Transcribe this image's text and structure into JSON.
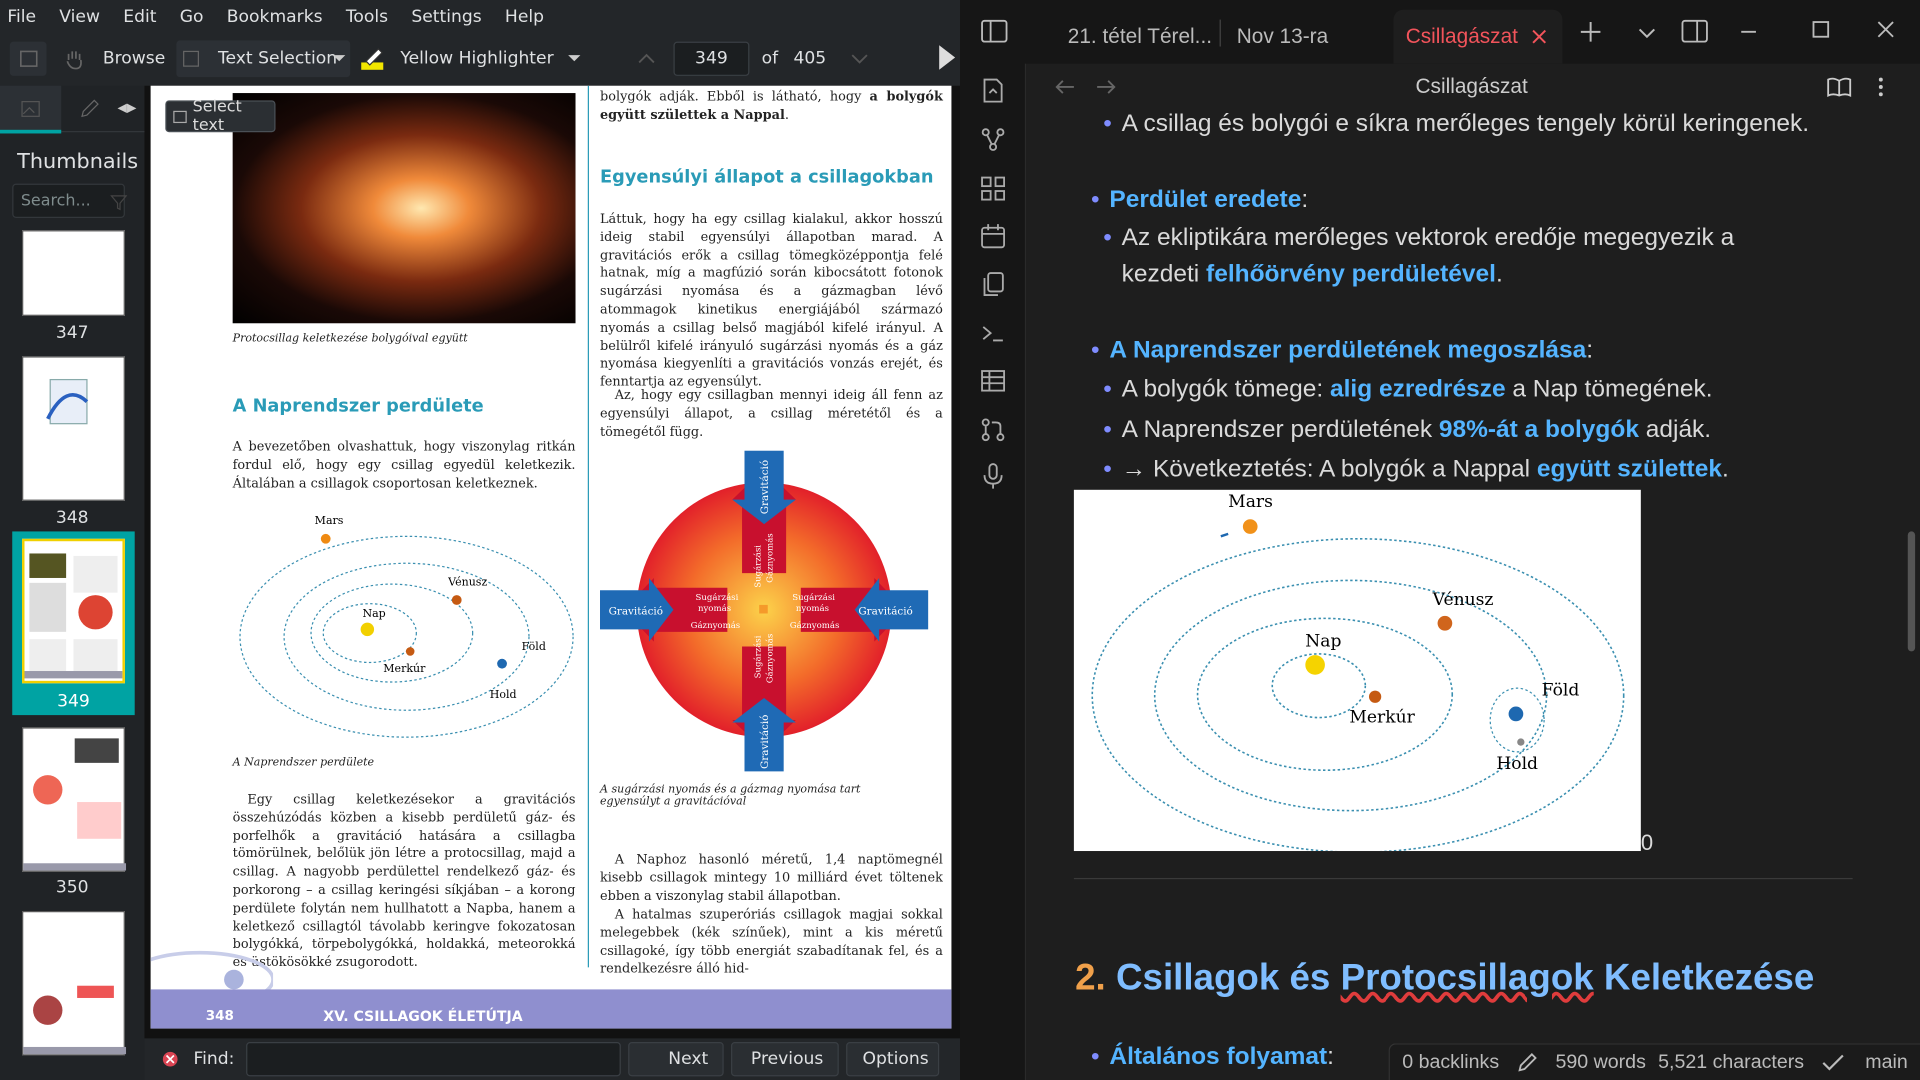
{
  "okular": {
    "menu": [
      "File",
      "View",
      "Edit",
      "Go",
      "Bookmarks",
      "Tools",
      "Settings",
      "Help"
    ],
    "toolbar": {
      "browse": "Browse",
      "text_selection": "Text Selection",
      "highlighter": "Yellow Highlighter",
      "page_current": "349",
      "page_of": "of",
      "page_total": "405"
    },
    "tooltip": "Select text",
    "sidebar": {
      "title": "Thumbnails",
      "search_placeholder": "Search...",
      "pages": [
        "347",
        "348",
        "349",
        "350"
      ]
    },
    "find": {
      "label": "Find:",
      "next": "Next",
      "previous": "Previous",
      "options": "Options"
    },
    "left_page": {
      "caption1": "Protocsillag keletkezése bolygóival együtt",
      "heading": "A Naprendszer perdülete",
      "para1": "A bevezetőben olvashattuk, hogy viszonylag ritkán fordul elő, hogy egy csillag egyedül keletkezik. Általában a csillagok csoportosan keletkeznek.",
      "planets": {
        "mars": "Mars",
        "venus": "Vénusz",
        "sun": "Nap",
        "mercury": "Merkúr",
        "earth": "Föld",
        "moon": "Hold"
      },
      "caption2": "A Naprendszer perdülete",
      "para2": "Egy csillag keletkezésekor a gravitációs összehúzódás közben a kisebb perdületű gáz- és porfelhők a gravitáció hatására a csillagba tömörülnek, belőlük jön létre a protocsillag, majd a csillag. A nagyobb perdülettel rendelkező gáz- és porkorong – a csillag keringési síkjában – a korong perdülete folytán nem hullhatott a Napba, hanem a keletkező csillagtól távolabb keringve fokozatosan bolygókká, törpebolygókká, holdakká, meteorokká és üstökösökké zsugorodott.",
      "footer_num": "348",
      "footer_title": "XV. CSILLAGOK ÉLETÚTJA"
    },
    "right_page": {
      "intro_plain": "bolygók adják. Ebből is látható, hogy ",
      "intro_bold": "a bolygók együtt születtek a Nappal",
      "heading": "Egyensúlyi állapot a csillagokban",
      "para1": "Láttuk, hogy ha egy csillag kialakul, akkor hosszú ideig stabil egyensúlyi állapotban marad. A gravitációs erők a csillag tömegközéppontja felé hatnak, míg a magfúzió során kibocsátott fotonok sugárzási nyomása és a gázmagban lévő atommagok kinetikus energiájából származó nyomás a csillag belső magjából kifelé irányul. A belülről kifelé irányuló sugárzási nyomás és a gáz nyomása kiegyenlíti a gravitációs vonzás erejét, és fenntartja az egyensúlyt.",
      "para2": "Az, hogy egy csillagban mennyi ideig áll fenn az egyensúlyi állapot, a csillag méretétől és a tömegétől függ.",
      "diagram": {
        "gravity": "Gravitáció",
        "pressure_a": "Sugárzási",
        "pressure_b": "nyomás",
        "pressure_c": "Gáznyomás"
      },
      "caption": "A sugárzási nyomás és a gázmag nyomása tart egyensúlyt a gravitációval",
      "para3": "A Naphoz hasonló méretű, 1,4 naptömegnél kisebb csillagok mintegy 10 milliárd évet töltenek ebben a viszonylag stabil állapotban.",
      "para4": "A hatalmas szuperóriás csillagok magjai sokkal melegebbek (kék színűek), mint a kis méretű csillagoké, így több energiát szabadítanak fel, és a rendelkezésre álló hid-"
    }
  },
  "obsidian": {
    "tabs": [
      "21. tétel Térel...",
      "Nov 13-ra",
      "Csillagászat"
    ],
    "note_title": "Csillagászat",
    "lines": {
      "l1": "A csillag és bolygói e síkra merőleges tengely körül keringenek.",
      "l2_hl": "Perdület eredete",
      "l3a": "Az ekliptikára merőleges vektorok eredője megegyezik a",
      "l3b_plain": "kezdeti ",
      "l3b_hl": "felhőörvény perdületével",
      "l4_hl": "A Naprendszer perdületének megoszlása",
      "l5_plain": "A bolygók tömege: ",
      "l5_hl": "alig ezredrésze",
      "l5_tail": " a Nap tömegének.",
      "l6_plain": "A Naprendszer perdületének ",
      "l6_hl": "98%-át a bolygók",
      "l6_tail": " adják.",
      "l7_plain": "→ Következtetés: A bolygók a Nappal ",
      "l7_hl": "együtt születtek",
      "l7_tail": ".",
      "after_image": "0",
      "h2_num": "2.",
      "h2_a": "Csillagok és ",
      "h2_b": "Protocsillagok",
      "h2_c": " Keletkezése",
      "l8_hl": "Általános folyamat"
    },
    "image_labels": {
      "mars": "Mars",
      "venus": "Vénusz",
      "sun": "Nap",
      "mercury": "Merkúr",
      "earth": "Föld",
      "moon": "Hold"
    },
    "status": {
      "backlinks": "0 backlinks",
      "words": "590 words",
      "chars": "5,521 characters",
      "branch": "main"
    }
  }
}
